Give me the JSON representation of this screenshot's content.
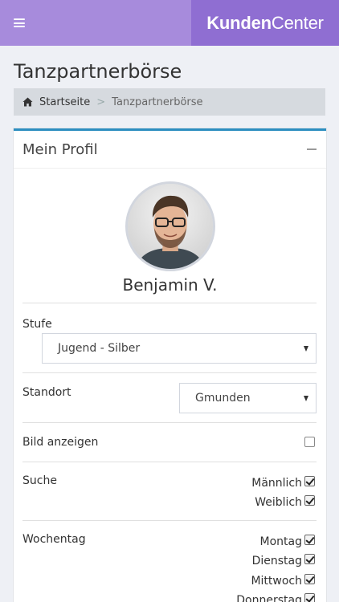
{
  "header": {
    "brand_bold": "Kunden",
    "brand_light": "Center"
  },
  "page": {
    "title": "Tanzpartnerbörse"
  },
  "breadcrumb": {
    "home": "Startseite",
    "separator": ">",
    "current": "Tanzpartnerbörse"
  },
  "panel": {
    "title": "Mein Profil",
    "profile_name": "Benjamin V.",
    "stufe": {
      "label": "Stufe",
      "value": "Jugend - Silber"
    },
    "standort": {
      "label": "Standort",
      "value": "Gmunden"
    },
    "bild": {
      "label": "Bild anzeigen",
      "checked": false
    },
    "suche": {
      "label": "Suche",
      "options": [
        {
          "label": "Männlich",
          "checked": true
        },
        {
          "label": "Weiblich",
          "checked": true
        }
      ]
    },
    "wochentag": {
      "label": "Wochentag",
      "options": [
        {
          "label": "Montag",
          "checked": true
        },
        {
          "label": "Dienstag",
          "checked": true
        },
        {
          "label": "Mittwoch",
          "checked": true
        },
        {
          "label": "Donnerstag",
          "checked": true
        }
      ]
    }
  },
  "colors": {
    "header": "#a78bdc",
    "brand_box": "#8f6ed2",
    "panel_accent": "#2c8ec0"
  },
  "icons": [
    "hamburger-menu-icon",
    "home-icon",
    "collapse-minus-icon",
    "dropdown-caret-icon",
    "checkbox-icon"
  ]
}
